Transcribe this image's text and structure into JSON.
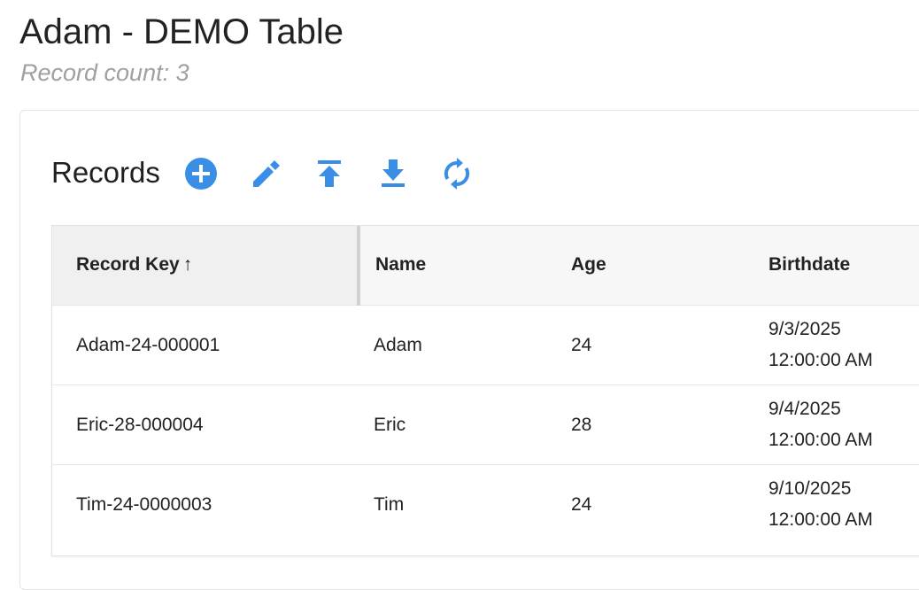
{
  "header": {
    "title": "Adam - DEMO Table",
    "subtitle": "Record count: 3"
  },
  "records": {
    "heading": "Records",
    "toolbar": [
      {
        "icon": "plus-circle-icon",
        "action": "add-record"
      },
      {
        "icon": "pencil-icon",
        "action": "edit-record"
      },
      {
        "icon": "upload-icon",
        "action": "upload"
      },
      {
        "icon": "download-icon",
        "action": "download"
      },
      {
        "icon": "refresh-icon",
        "action": "refresh"
      }
    ],
    "accent_color": "#3a8ee6"
  },
  "table": {
    "columns": {
      "key": "Record Key",
      "key_sort": "↑",
      "name": "Name",
      "age": "Age",
      "birthdate": "Birthdate"
    },
    "rows": [
      {
        "key": "Adam-24-000001",
        "name": "Adam",
        "age": "24",
        "birthdate_date": "9/3/2025",
        "birthdate_time": "12:00:00 AM"
      },
      {
        "key": "Eric-28-000004",
        "name": "Eric",
        "age": "28",
        "birthdate_date": "9/4/2025",
        "birthdate_time": "12:00:00 AM"
      },
      {
        "key": "Tim-24-0000003",
        "name": "Tim",
        "age": "24",
        "birthdate_date": "9/10/2025",
        "birthdate_time": "12:00:00 AM"
      }
    ]
  }
}
